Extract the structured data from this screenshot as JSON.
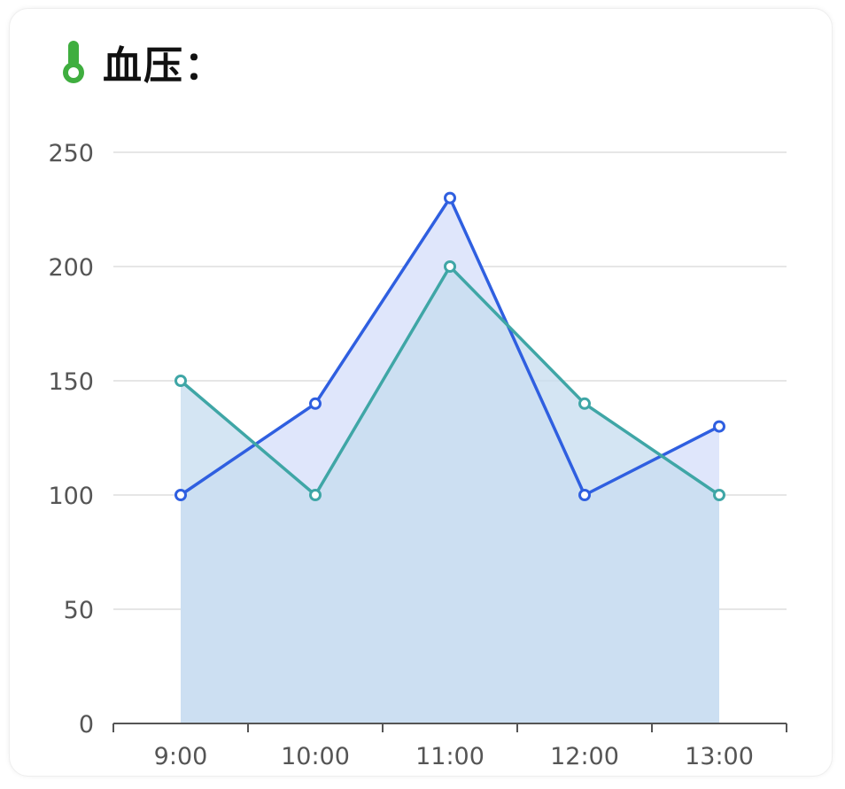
{
  "header": {
    "title": "血压：",
    "icon": "thermometer-icon",
    "icon_color": "#3fae3f"
  },
  "chart_data": {
    "type": "area",
    "categories": [
      "9:00",
      "10:00",
      "11:00",
      "12:00",
      "13:00"
    ],
    "series": [
      {
        "name": "",
        "values": [
          100,
          140,
          230,
          100,
          130
        ],
        "color": "#2f5fe0",
        "fill": "#dfe6fb"
      },
      {
        "name": "",
        "values": [
          150,
          100,
          200,
          140,
          100
        ],
        "color": "#3fa6a6",
        "fill": "#c5dcef"
      }
    ],
    "yticks": [
      0,
      50,
      100,
      150,
      200,
      250
    ],
    "ylim": [
      0,
      250
    ],
    "grid": true,
    "title": "",
    "xlabel": "",
    "ylabel": ""
  }
}
